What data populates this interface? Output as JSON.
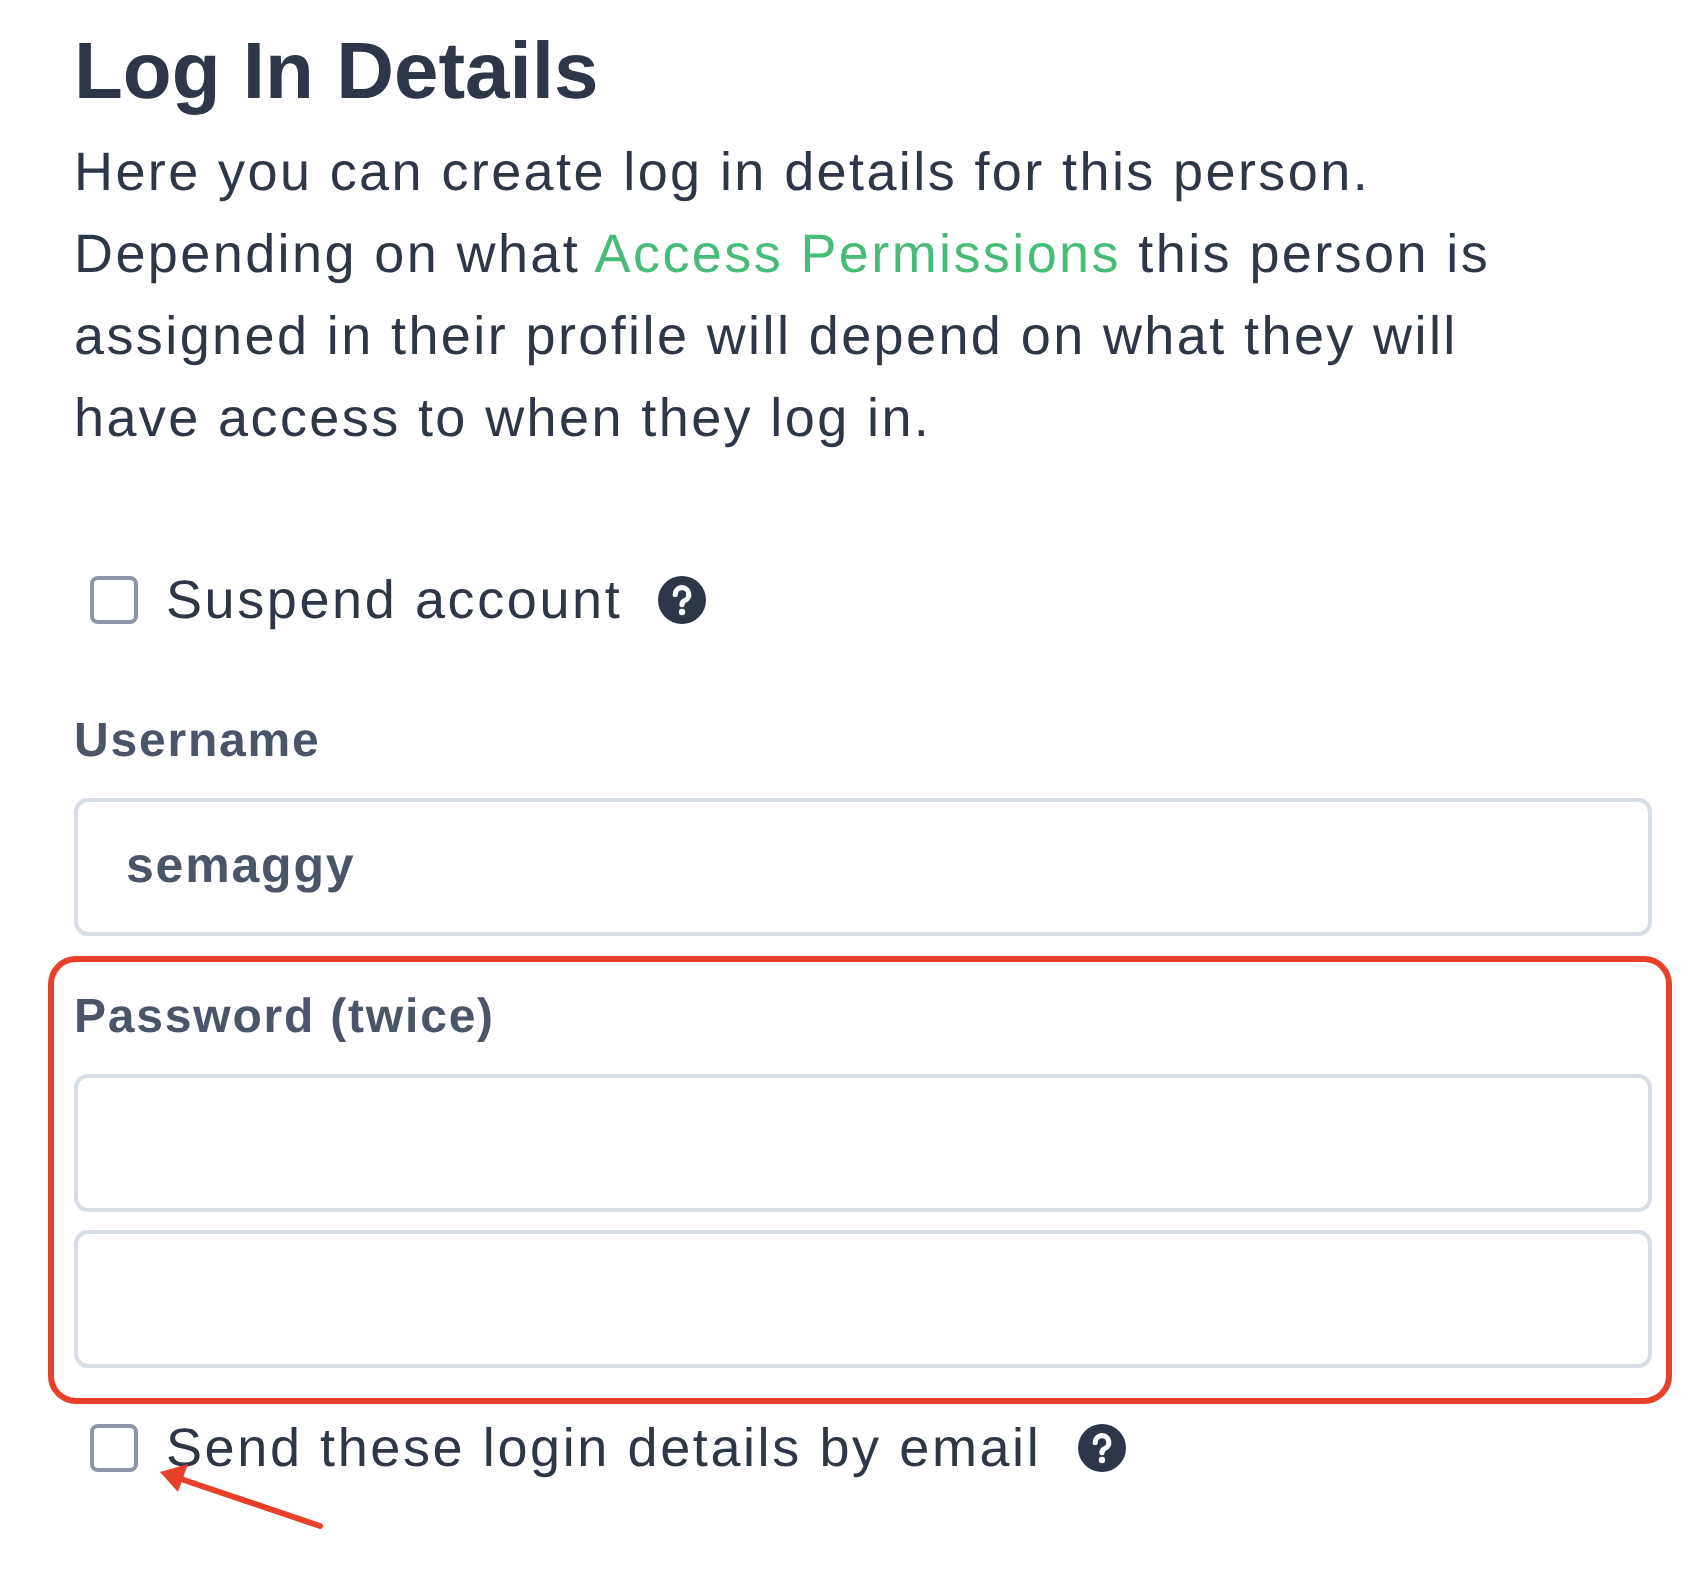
{
  "title": "Log In Details",
  "description": {
    "before": "Here you can create log in details for this person. Depending on what ",
    "link": "Access Permissions",
    "after": " this person is assigned in their profile will depend on what they will have access to when they log in."
  },
  "suspend": {
    "label": "Suspend account",
    "checked": false,
    "help": true
  },
  "username": {
    "label": "Username",
    "value": "semaggy"
  },
  "password": {
    "label": "Password (twice)",
    "inputs": [
      {
        "kind": "password"
      },
      {
        "kind": "password"
      }
    ]
  },
  "send_email": {
    "label": "Send these login details by email",
    "checked": false,
    "help": true
  }
}
